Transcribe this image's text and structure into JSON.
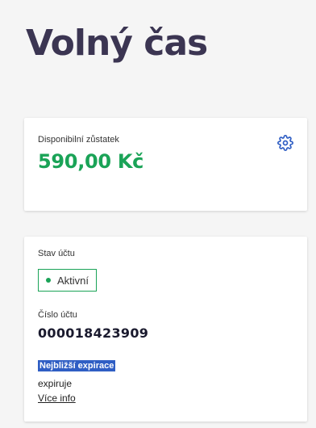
{
  "page": {
    "title": "Volný čas"
  },
  "balance": {
    "label": "Disponibilní zůstatek",
    "value": "590,00 Kč",
    "value_color": "#1aa357",
    "settings_icon": "gear-icon"
  },
  "account": {
    "status_label": "Stav účtu",
    "status_value": "Aktivní",
    "status_color": "#1aa357",
    "number_label": "Číslo účtu",
    "number_value": "000018423909",
    "expiration_heading": "Nejbližší expirace",
    "expiration_text": "expiruje",
    "more_info_link": "Více info"
  }
}
